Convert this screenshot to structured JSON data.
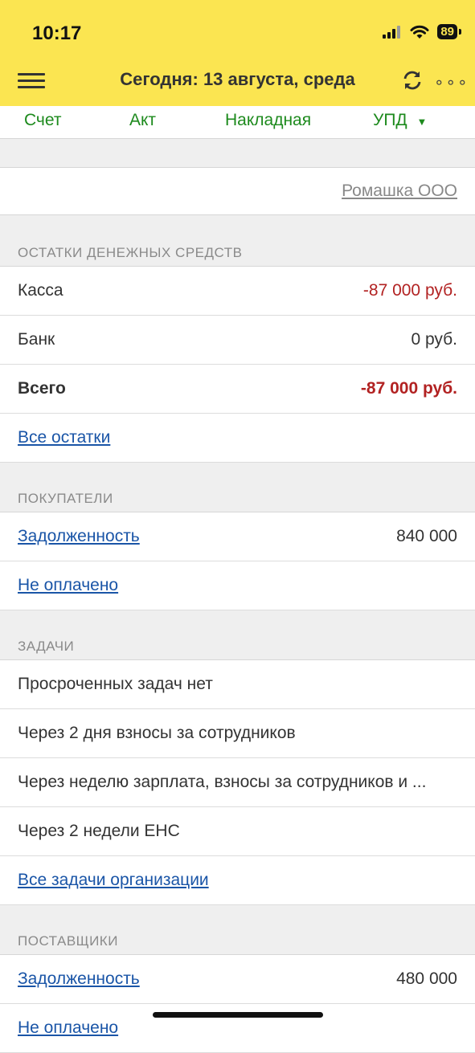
{
  "status": {
    "time": "10:17",
    "battery": "89"
  },
  "header": {
    "title": "Сегодня: 13 августа, среда",
    "more": "∘∘∘"
  },
  "docs": {
    "invoice": "Счет",
    "act": "Акт",
    "waybill": "Накладная",
    "upd": "УПД",
    "upd_arrow": "▼"
  },
  "organization": "Ромашка ООО",
  "cash": {
    "heading": "ОСТАТКИ ДЕНЕЖНЫХ СРЕДСТВ",
    "rows": [
      {
        "label": "Касса",
        "value": "-87 000 руб."
      },
      {
        "label": "Банк",
        "value": "0 руб."
      },
      {
        "label": "Всего",
        "value": "-87 000 руб."
      }
    ],
    "all_link": "Все остатки"
  },
  "buyers": {
    "heading": "ПОКУПАТЕЛИ",
    "debt_label": "Задолженность",
    "debt_value": "840 000",
    "unpaid": "Не оплачено"
  },
  "tasks": {
    "heading": "ЗАДАЧИ",
    "items": [
      "Просроченных задач нет",
      "Через 2 дня взносы за сотрудников",
      "Через неделю зарплата, взносы за сотрудников и ...",
      "Через 2 недели ЕНС"
    ],
    "all_link": "Все задачи организации"
  },
  "suppliers": {
    "heading": "ПОСТАВЩИКИ",
    "debt_label": "Задолженность",
    "debt_value": "480 000",
    "unpaid": "Не оплачено"
  },
  "colors": {
    "header_bg": "#fbe551",
    "doc_link": "#1d8a1d",
    "negative": "#b22222",
    "link": "#1a55a7"
  }
}
